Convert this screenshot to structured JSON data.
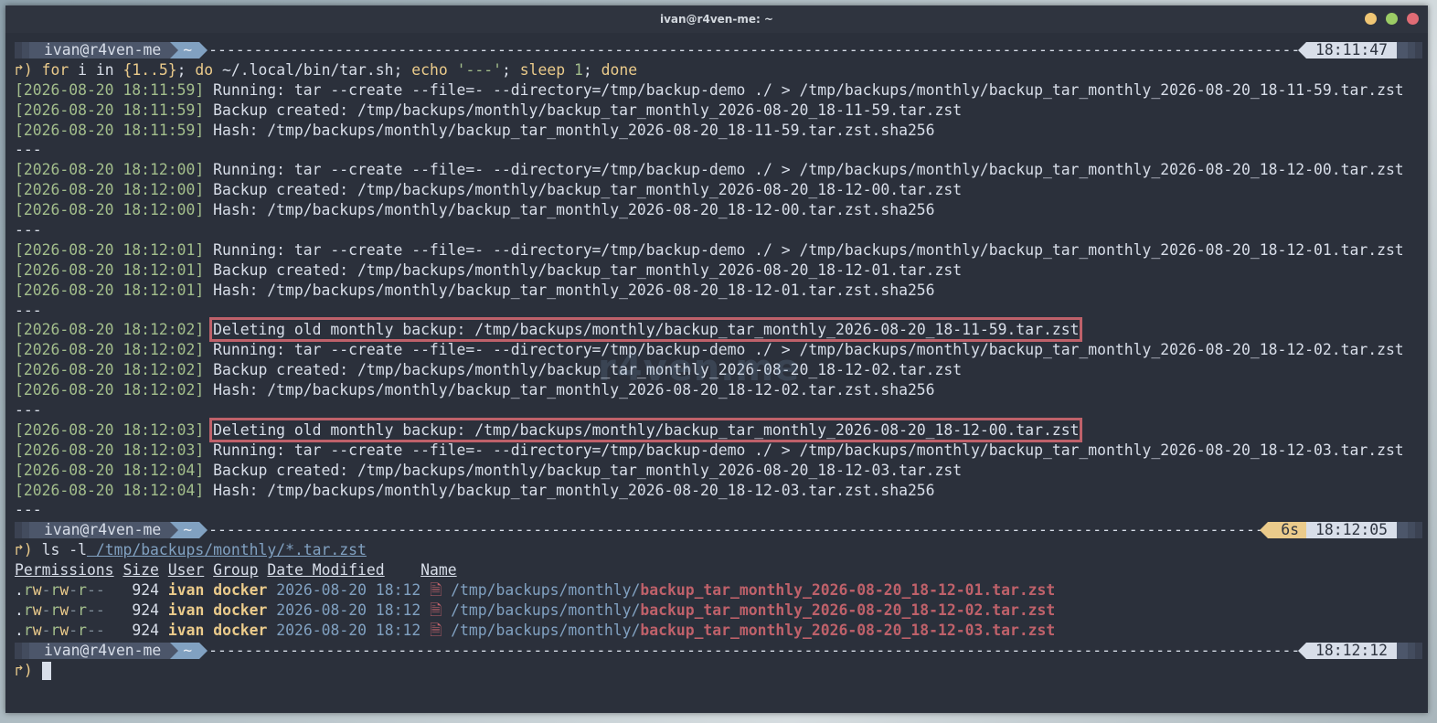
{
  "window": {
    "title": "ivan@r4ven-me: ~"
  },
  "prompt": {
    "user": "ivan@r4ven-me",
    "dir": "~",
    "arrow": "↱)"
  },
  "prompts": [
    {
      "time": "18:11:47",
      "duration": ""
    },
    {
      "time": "18:12:05",
      "duration": "6s"
    },
    {
      "time": "18:12:12",
      "duration": ""
    }
  ],
  "cmd1": {
    "for_kw": "for",
    "rest1": " i in ",
    "brace": "{1..5}",
    "semi1": "; ",
    "do_kw": "do",
    "rest2": " ~/.local/bin/tar.sh",
    "semi2": "; ",
    "echo": "echo",
    "str": " '---'",
    "semi3": "; ",
    "sleep": "sleep",
    "num": " 1",
    "semi4": "; ",
    "done": "done"
  },
  "log": [
    {
      "ts": "[2026-08-20 18:11:59]",
      "msg": " Running: tar --create --file=- --directory=/tmp/backup-demo ./ > /tmp/backups/monthly/backup_tar_monthly_2026-08-20_18-11-59.tar.zst",
      "hl": false
    },
    {
      "ts": "[2026-08-20 18:11:59]",
      "msg": " Backup created: /tmp/backups/monthly/backup_tar_monthly_2026-08-20_18-11-59.tar.zst",
      "hl": false
    },
    {
      "ts": "[2026-08-20 18:11:59]",
      "msg": " Hash: /tmp/backups/monthly/backup_tar_monthly_2026-08-20_18-11-59.tar.zst.sha256",
      "hl": false
    },
    {
      "sep": "---"
    },
    {
      "ts": "[2026-08-20 18:12:00]",
      "msg": " Running: tar --create --file=- --directory=/tmp/backup-demo ./ > /tmp/backups/monthly/backup_tar_monthly_2026-08-20_18-12-00.tar.zst",
      "hl": false
    },
    {
      "ts": "[2026-08-20 18:12:00]",
      "msg": " Backup created: /tmp/backups/monthly/backup_tar_monthly_2026-08-20_18-12-00.tar.zst",
      "hl": false
    },
    {
      "ts": "[2026-08-20 18:12:00]",
      "msg": " Hash: /tmp/backups/monthly/backup_tar_monthly_2026-08-20_18-12-00.tar.zst.sha256",
      "hl": false
    },
    {
      "sep": "---"
    },
    {
      "ts": "[2026-08-20 18:12:01]",
      "msg": " Running: tar --create --file=- --directory=/tmp/backup-demo ./ > /tmp/backups/monthly/backup_tar_monthly_2026-08-20_18-12-01.tar.zst",
      "hl": false
    },
    {
      "ts": "[2026-08-20 18:12:01]",
      "msg": " Backup created: /tmp/backups/monthly/backup_tar_monthly_2026-08-20_18-12-01.tar.zst",
      "hl": false
    },
    {
      "ts": "[2026-08-20 18:12:01]",
      "msg": " Hash: /tmp/backups/monthly/backup_tar_monthly_2026-08-20_18-12-01.tar.zst.sha256",
      "hl": false
    },
    {
      "sep": "---"
    },
    {
      "ts": "[2026-08-20 18:12:02]",
      "msg": "Deleting old monthly backup: /tmp/backups/monthly/backup_tar_monthly_2026-08-20_18-11-59.tar.zst",
      "hl": true
    },
    {
      "ts": "[2026-08-20 18:12:02]",
      "msg": " Running: tar --create --file=- --directory=/tmp/backup-demo ./ > /tmp/backups/monthly/backup_tar_monthly_2026-08-20_18-12-02.tar.zst",
      "hl": false
    },
    {
      "ts": "[2026-08-20 18:12:02]",
      "msg": " Backup created: /tmp/backups/monthly/backup_tar_monthly_2026-08-20_18-12-02.tar.zst",
      "hl": false
    },
    {
      "ts": "[2026-08-20 18:12:02]",
      "msg": " Hash: /tmp/backups/monthly/backup_tar_monthly_2026-08-20_18-12-02.tar.zst.sha256",
      "hl": false
    },
    {
      "sep": "---"
    },
    {
      "ts": "[2026-08-20 18:12:03]",
      "msg": "Deleting old monthly backup: /tmp/backups/monthly/backup_tar_monthly_2026-08-20_18-12-00.tar.zst",
      "hl": true
    },
    {
      "ts": "[2026-08-20 18:12:03]",
      "msg": " Running: tar --create --file=- --directory=/tmp/backup-demo ./ > /tmp/backups/monthly/backup_tar_monthly_2026-08-20_18-12-03.tar.zst",
      "hl": false
    },
    {
      "ts": "[2026-08-20 18:12:04]",
      "msg": " Backup created: /tmp/backups/monthly/backup_tar_monthly_2026-08-20_18-12-03.tar.zst",
      "hl": false
    },
    {
      "ts": "[2026-08-20 18:12:04]",
      "msg": " Hash: /tmp/backups/monthly/backup_tar_monthly_2026-08-20_18-12-03.tar.zst.sha256",
      "hl": false
    },
    {
      "sep": "---"
    }
  ],
  "cmd2": {
    "ls": "ls",
    "flag": " -l",
    "path": " /tmp/backups/monthly/*.tar.zst"
  },
  "ls_headers": [
    "Permissions",
    "Size",
    "User",
    "Group",
    "Date Modified",
    "Name"
  ],
  "ls_rows": [
    {
      "dot": ".",
      "r1": "r",
      "w1": "w",
      "x1": "-",
      "r2": "r",
      "w2": "w",
      "x2": "-",
      "r3": "r",
      "w3": "-",
      "x3": "-",
      "size": "924",
      "user": "ivan",
      "group": "docker",
      "date": "2026-08-20 18:12",
      "icon": "🗎",
      "dir": "/tmp/backups/monthly/",
      "file": "backup_tar_monthly_2026-08-20_18-12-01.tar.zst"
    },
    {
      "dot": ".",
      "r1": "r",
      "w1": "w",
      "x1": "-",
      "r2": "r",
      "w2": "w",
      "x2": "-",
      "r3": "r",
      "w3": "-",
      "x3": "-",
      "size": "924",
      "user": "ivan",
      "group": "docker",
      "date": "2026-08-20 18:12",
      "icon": "🗎",
      "dir": "/tmp/backups/monthly/",
      "file": "backup_tar_monthly_2026-08-20_18-12-02.tar.zst"
    },
    {
      "dot": ".",
      "r1": "r",
      "w1": "w",
      "x1": "-",
      "r2": "r",
      "w2": "w",
      "x2": "-",
      "r3": "r",
      "w3": "-",
      "x3": "-",
      "size": "924",
      "user": "ivan",
      "group": "docker",
      "date": "2026-08-20 18:12",
      "icon": "🗎",
      "dir": "/tmp/backups/monthly/",
      "file": "backup_tar_monthly_2026-08-20_18-12-03.tar.zst"
    }
  ],
  "watermark": "r4ven.me"
}
